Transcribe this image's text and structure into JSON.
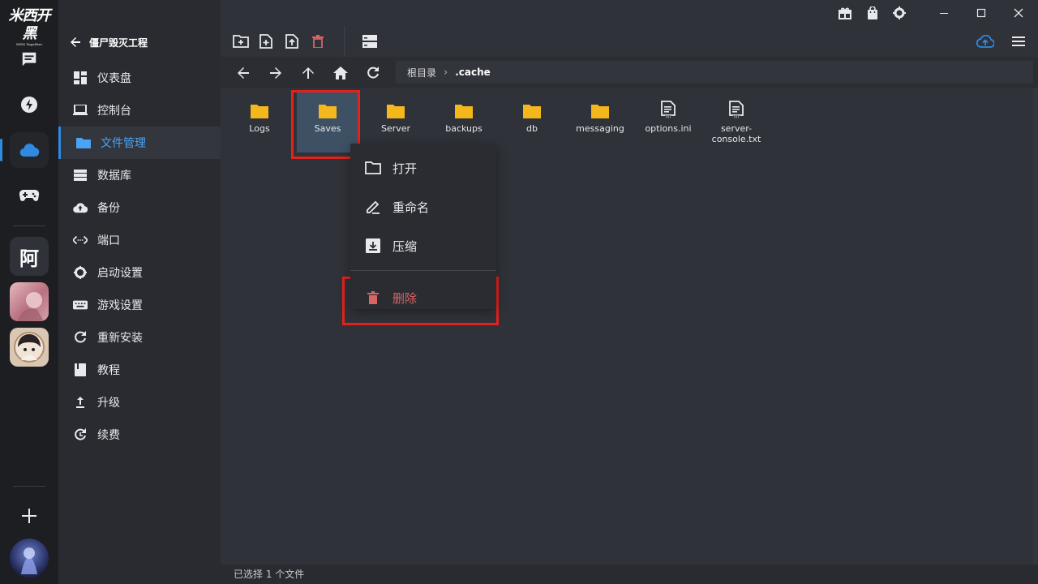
{
  "app": {
    "logo_text": "米西开黑",
    "logo_sub": "MIXI Together"
  },
  "rail": {
    "items": [
      {
        "icon": "chat-icon"
      },
      {
        "icon": "discover-icon"
      },
      {
        "icon": "cloud-icon",
        "active": true
      },
      {
        "icon": "gamepad-icon"
      }
    ],
    "text_avatar": "阿",
    "add_icon": "plus-icon"
  },
  "sidebar": {
    "back_label": "僵尸毁灭工程",
    "items": [
      {
        "label": "仪表盘",
        "icon": "dashboard-icon"
      },
      {
        "label": "控制台",
        "icon": "console-icon"
      },
      {
        "label": "文件管理",
        "icon": "folder-icon",
        "active": true
      },
      {
        "label": "数据库",
        "icon": "database-icon"
      },
      {
        "label": "备份",
        "icon": "backup-icon"
      },
      {
        "label": "端口",
        "icon": "port-icon"
      },
      {
        "label": "启动设置",
        "icon": "gear-icon"
      },
      {
        "label": "游戏设置",
        "icon": "keyboard-icon"
      },
      {
        "label": "重新安装",
        "icon": "reinstall-icon"
      },
      {
        "label": "教程",
        "icon": "book-icon"
      },
      {
        "label": "升级",
        "icon": "upgrade-icon"
      },
      {
        "label": "续费",
        "icon": "renew-icon"
      }
    ]
  },
  "breadcrumb": {
    "root": "根目录",
    "current": ".cache"
  },
  "files": [
    {
      "name": "Logs",
      "type": "folder"
    },
    {
      "name": "Saves",
      "type": "folder",
      "selected": true
    },
    {
      "name": "Server",
      "type": "folder"
    },
    {
      "name": "backups",
      "type": "folder"
    },
    {
      "name": "db",
      "type": "folder"
    },
    {
      "name": "messaging",
      "type": "folder"
    },
    {
      "name": "options.ini",
      "type": "file"
    },
    {
      "name": "server-console.txt",
      "type": "file"
    }
  ],
  "context_menu": {
    "open": "打开",
    "rename": "重命名",
    "compress": "压缩",
    "delete": "删除"
  },
  "status": {
    "text": "已选择 1 个文件"
  },
  "colors": {
    "accent": "#2f8ae0",
    "folder": "#f5b81c",
    "danger": "#d96464",
    "highlight_box": "#e3221b"
  }
}
